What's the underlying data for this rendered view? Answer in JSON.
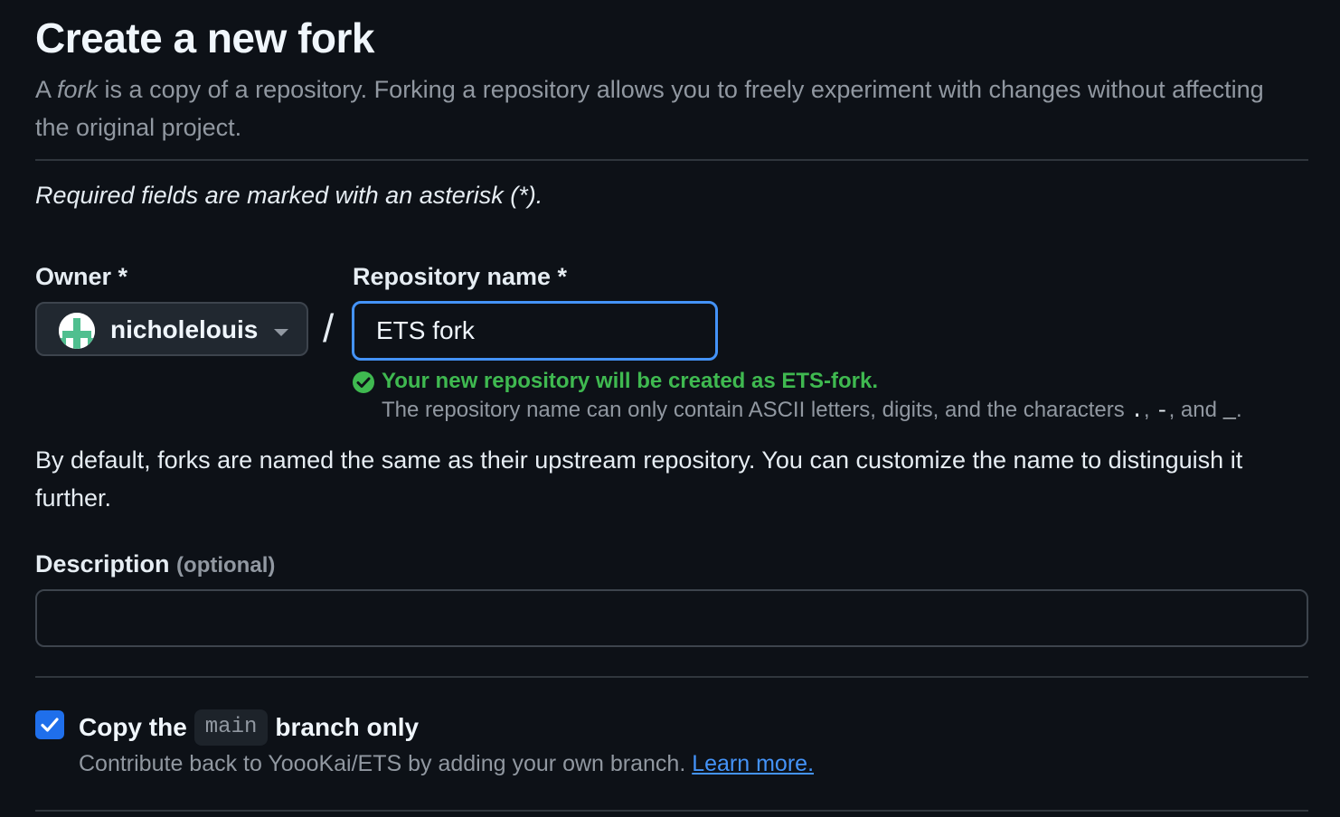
{
  "page": {
    "title": "Create a new fork",
    "intro_prefix": "A ",
    "intro_em": "fork",
    "intro_suffix": " is a copy of a repository. Forking a repository allows you to freely experiment with changes without affecting the original project.",
    "required_note": "Required fields are marked with an asterisk (*)."
  },
  "owner": {
    "label": "Owner *",
    "value": "nicholelouis"
  },
  "separator": "/",
  "repository": {
    "label": "Repository name *",
    "value": "ETS fork",
    "success_message": "Your new repository will be created as ETS-fork.",
    "hint_prefix": "The repository name can only contain ASCII letters, digits, and the characters ",
    "hint_char1": ".",
    "hint_sep1": ", ",
    "hint_char2": "-",
    "hint_sep2": ", and ",
    "hint_char3": "_",
    "hint_end": "."
  },
  "default_note": "By default, forks are named the same as their upstream repository. You can customize the name to distinguish it further.",
  "description": {
    "label": "Description",
    "optional": "(optional)",
    "value": ""
  },
  "copy_branch": {
    "checked": true,
    "label_prefix": "Copy the",
    "branch": "main",
    "label_suffix": "branch only",
    "help_text": "Contribute back to YoooKai/ETS by adding your own branch.",
    "link_text": "Learn more."
  },
  "colors": {
    "background": "#0d1117",
    "accent": "#4493f8",
    "success": "#3fb950",
    "checkbox": "#1f6feb",
    "muted": "#9198a1"
  }
}
